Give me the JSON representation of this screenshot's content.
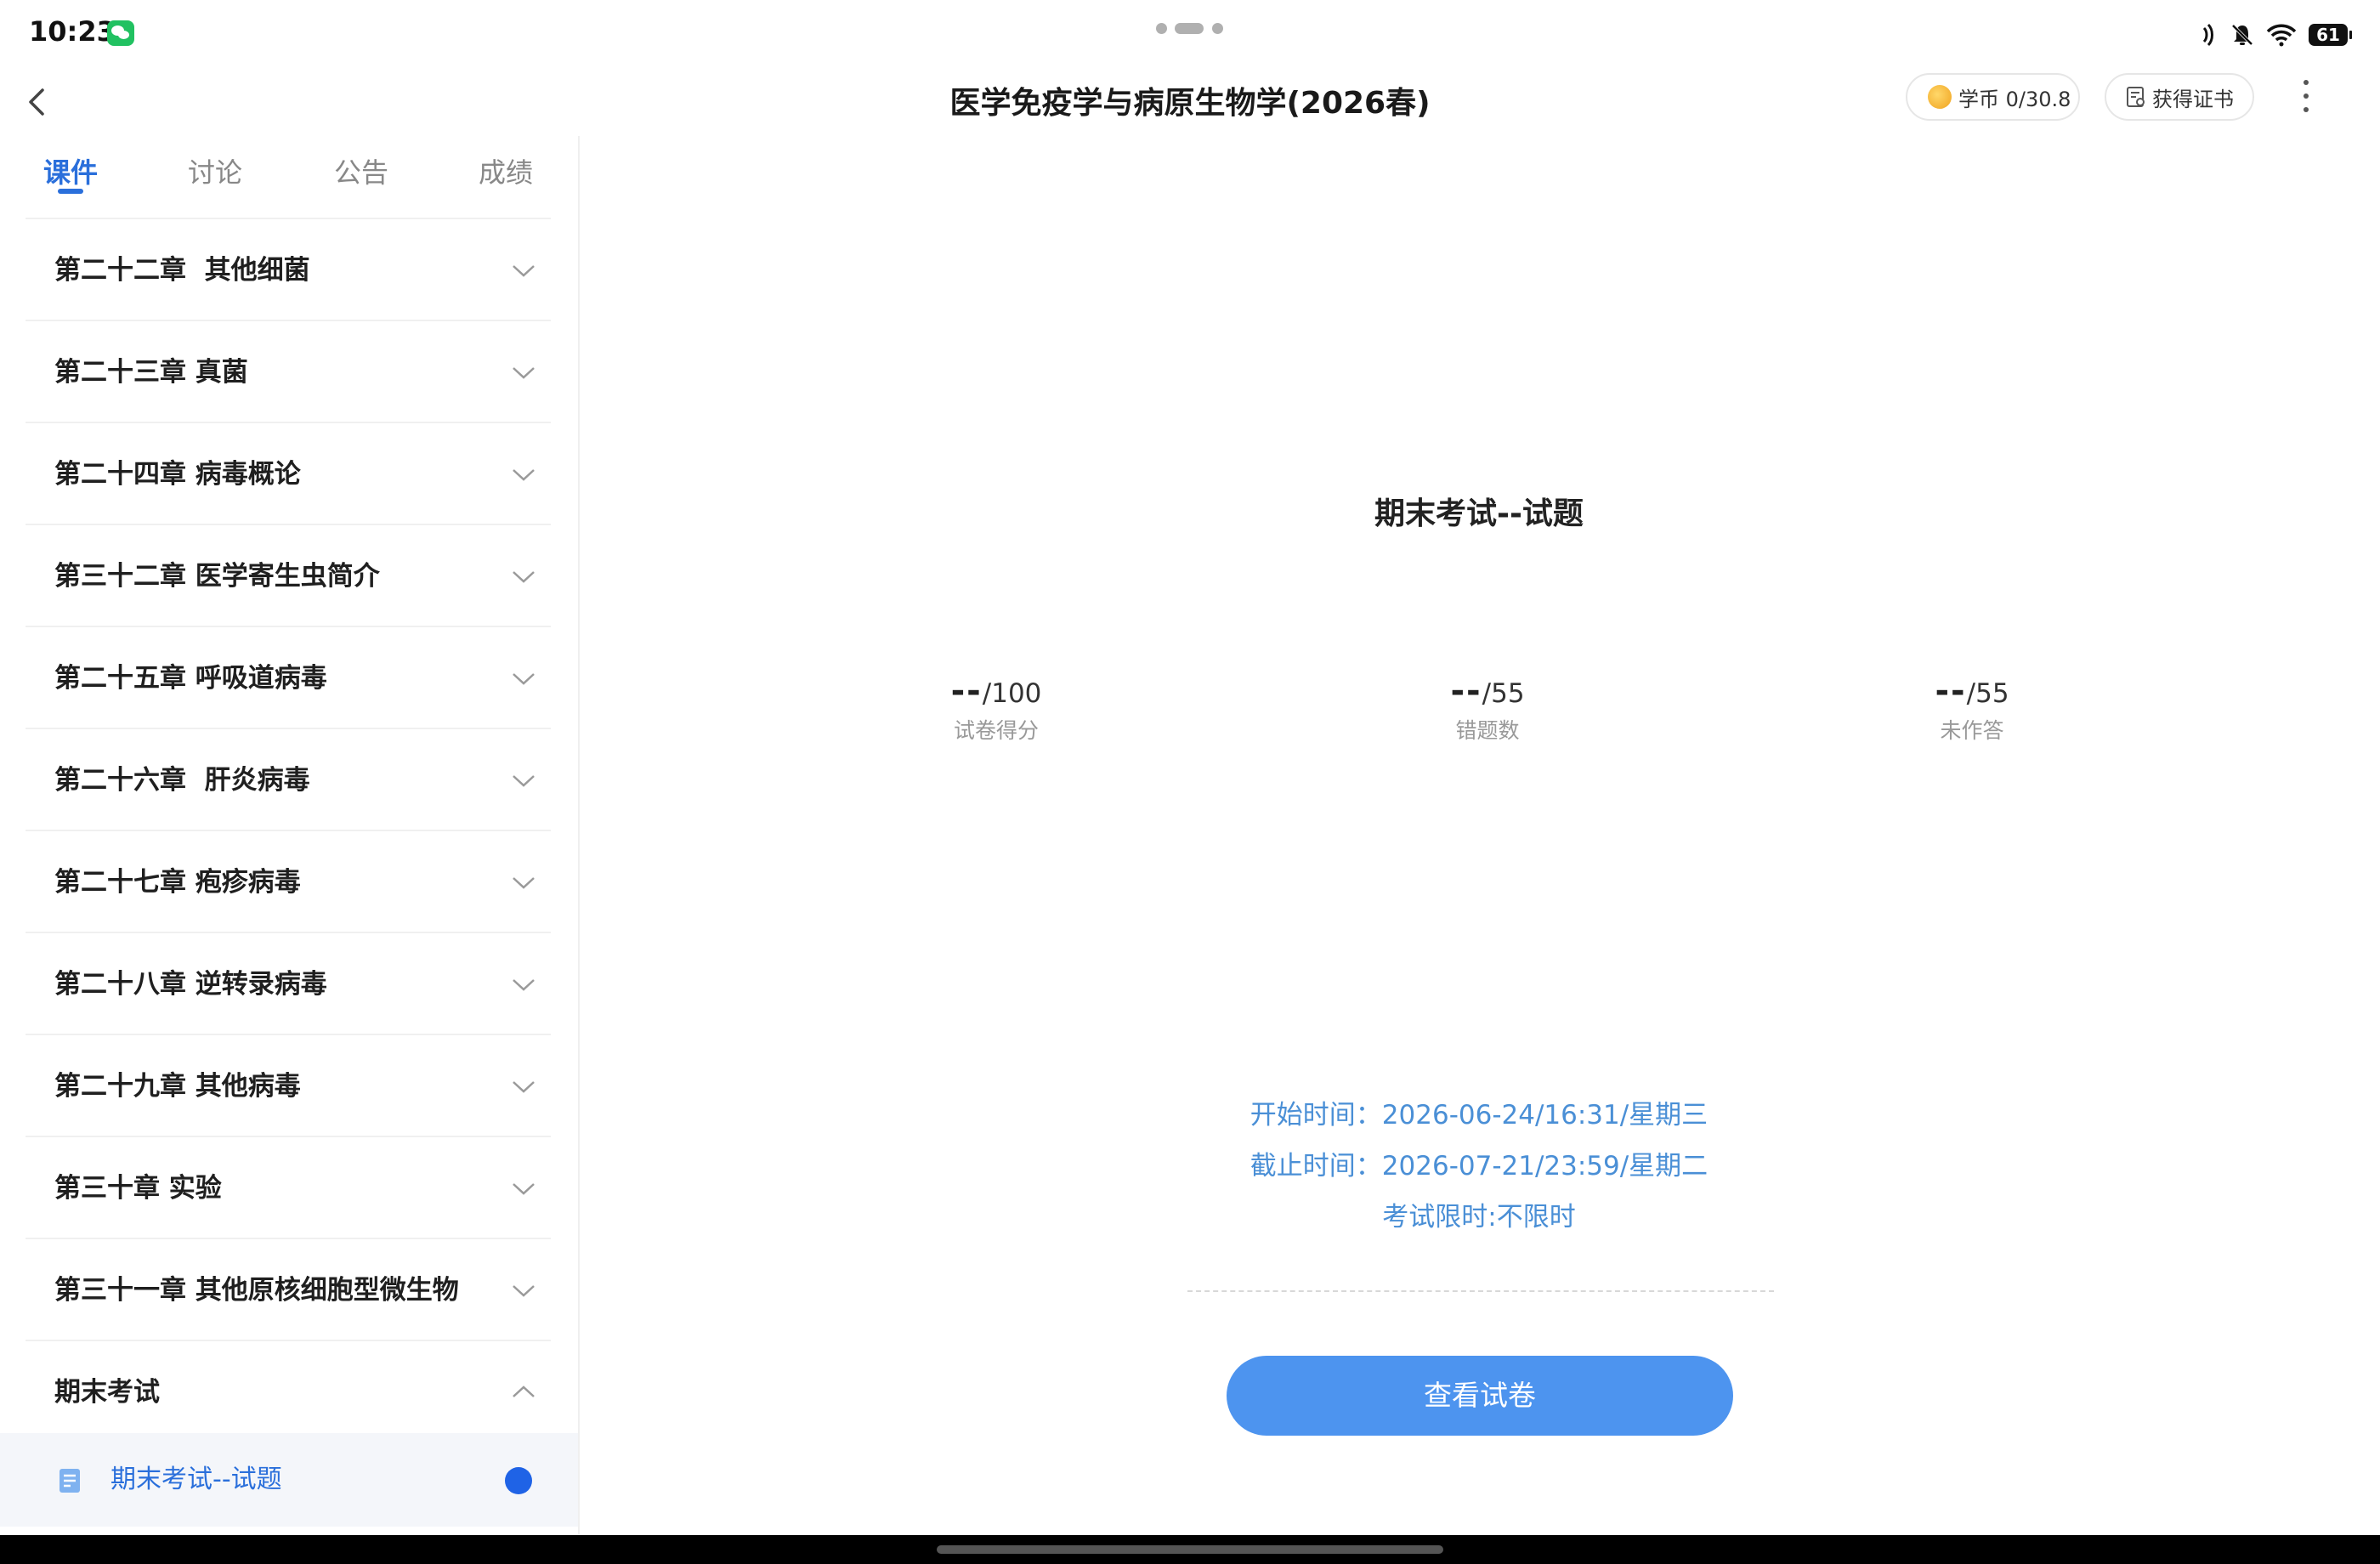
{
  "status_bar": {
    "time": "10:23",
    "battery": "61",
    "icons": [
      "wechat-icon",
      "nfc-icon",
      "mute-bell-icon",
      "wifi-icon",
      "battery-icon"
    ]
  },
  "header": {
    "title": "医学免疫学与病原生物学(2026春)",
    "coin_label": "学币 0/30.8",
    "certificate_label": "获得证书"
  },
  "sidebar": {
    "tabs": [
      {
        "label": "课件",
        "active": true
      },
      {
        "label": "讨论",
        "active": false
      },
      {
        "label": "公告",
        "active": false
      },
      {
        "label": "成绩",
        "active": false
      }
    ],
    "chapters": [
      {
        "label": "第二十二章  其他细菌",
        "expanded": false
      },
      {
        "label": "第二十三章 真菌",
        "expanded": false
      },
      {
        "label": "第二十四章 病毒概论",
        "expanded": false
      },
      {
        "label": "第三十二章 医学寄生虫简介",
        "expanded": false
      },
      {
        "label": "第二十五章 呼吸道病毒",
        "expanded": false
      },
      {
        "label": "第二十六章  肝炎病毒",
        "expanded": false
      },
      {
        "label": "第二十七章 疱疹病毒",
        "expanded": false
      },
      {
        "label": "第二十八章 逆转录病毒",
        "expanded": false
      },
      {
        "label": "第二十九章 其他病毒",
        "expanded": false
      },
      {
        "label": "第三十章 实验",
        "expanded": false
      },
      {
        "label": "第三十一章 其他原核细胞型微生物",
        "expanded": false
      },
      {
        "label": "期末考试",
        "expanded": true
      }
    ],
    "active_item": {
      "label": "期末考试--试题"
    }
  },
  "main": {
    "exam_title": "期末考试--试题",
    "stats": [
      {
        "value": "--",
        "total": "/100",
        "label": "试卷得分"
      },
      {
        "value": "--",
        "total": "/55",
        "label": "错题数"
      },
      {
        "value": "--",
        "total": "/55",
        "label": "未作答"
      }
    ],
    "start_time": "开始时间：2026-06-24/16:31/星期三",
    "end_time": "截止时间：2026-07-21/23:59/星期二",
    "time_limit": "考试限时:不限时",
    "view_button": "查看试卷"
  },
  "colors": {
    "accent": "#2a6fdb",
    "button": "#4d94ef",
    "time_text": "#4a8fd6"
  }
}
